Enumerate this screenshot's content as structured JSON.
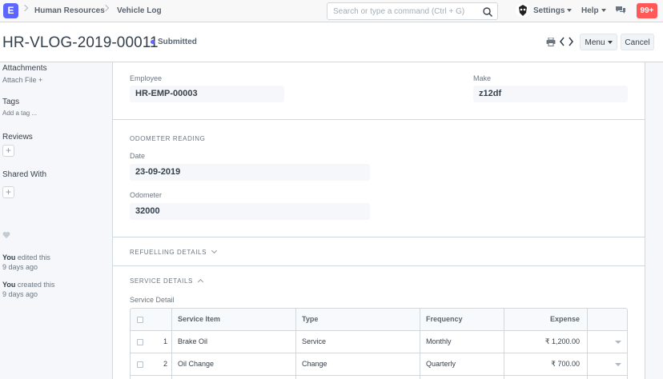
{
  "navbar": {
    "logo": "E",
    "breadcrumbs": [
      "Human Resources",
      "Vehicle Log"
    ],
    "search_placeholder": "Search or type a command (Ctrl + G)",
    "settings": "Settings",
    "help": "Help",
    "notifications": "99+"
  },
  "page": {
    "title": "HR-VLOG-2019-00011",
    "status": "Submitted",
    "menu_label": "Menu",
    "cancel_label": "Cancel"
  },
  "sidebar": {
    "attachments": "Attachments",
    "attach_file": "Attach File +",
    "tags": "Tags",
    "add_tag": "Add a tag ...",
    "reviews": "Reviews",
    "shared_with": "Shared With",
    "activity": [
      {
        "who": "You",
        "action": " edited this",
        "when": "9 days ago"
      },
      {
        "who": "You",
        "action": " created this",
        "when": "9 days ago"
      }
    ]
  },
  "form": {
    "employee_label": "Employee",
    "employee_value": "HR-EMP-00003",
    "make_label": "Make",
    "make_value": "z12df",
    "odometer_section": "ODOMETER READING",
    "date_label": "Date",
    "date_value": "23-09-2019",
    "odometer_label": "Odometer",
    "odometer_value": "32000",
    "refuelling_section": "REFUELLING DETAILS",
    "service_section": "SERVICE DETAILS",
    "service_detail_label": "Service Detail"
  },
  "service_table": {
    "columns": [
      "Service Item",
      "Type",
      "Frequency",
      "Expense"
    ],
    "rows": [
      {
        "no": "1",
        "item": "Brake Oil",
        "type": "Service",
        "frequency": "Monthly",
        "expense": "₹ 1,200.00"
      },
      {
        "no": "2",
        "item": "Oil Change",
        "type": "Change",
        "frequency": "Quarterly",
        "expense": "₹ 700.00"
      }
    ]
  }
}
